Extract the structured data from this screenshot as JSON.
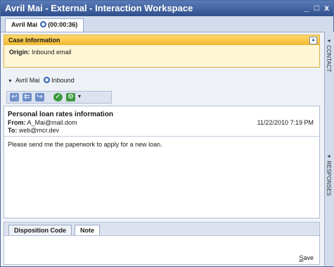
{
  "window": {
    "title": "Avril Mai - External - Interaction Workspace",
    "controls": "_ □ x"
  },
  "interaction_tab": {
    "name": "Avril Mai",
    "timer": "(00:00:36)"
  },
  "case_info": {
    "title": "Case Information",
    "collapse_glyph": "▴",
    "origin_label": "Origin:",
    "origin_value": "Inbound email"
  },
  "party": {
    "name": "Avril Mai",
    "direction": "Inbound"
  },
  "toolbar": {
    "icons": [
      "reply-icon",
      "reply-all-icon",
      "forward-icon",
      "done-icon",
      "more-actions-icon"
    ]
  },
  "email": {
    "subject": "Personal loan rates information",
    "from_label": "From:",
    "from": "A_Mai@mail.dom",
    "to_label": "To:",
    "to": "web@mcr.dev",
    "date": "11/22/2010 7:19 PM",
    "body": "Please send me the paperwork to apply for a new loan."
  },
  "disposition": {
    "tabs": [
      "Disposition Code",
      "Note"
    ],
    "save": "Save"
  },
  "side": {
    "contact": "CONTACT",
    "responses": "RESPONSES"
  },
  "colors": {
    "title_bar": "#2f4f8c",
    "case_header": "#f2b830",
    "accent": "#2d5fb3"
  }
}
